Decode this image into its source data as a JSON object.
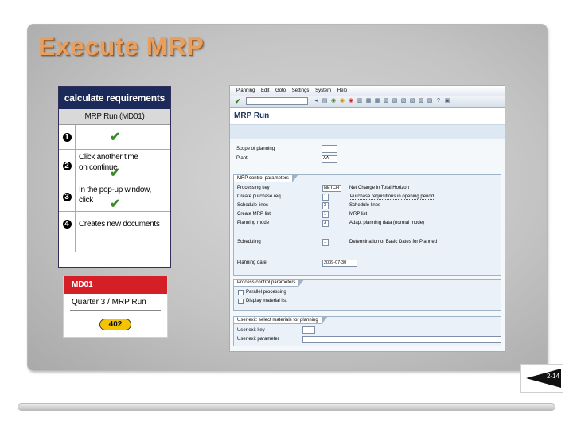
{
  "slide": {
    "title": "Execute MRP",
    "page_number": "2-14"
  },
  "steps_table": {
    "header": "calculate requirements",
    "subheader": "MRP Run (MD01)",
    "steps": [
      {
        "number": "1",
        "text": "",
        "checked": true
      },
      {
        "number": "2",
        "text": "Click another time on continue",
        "checked": true
      },
      {
        "number": "3",
        "text": "In the pop-up window, click",
        "checked": true
      },
      {
        "number": "4",
        "text": "Creates new documents",
        "checked": false
      }
    ]
  },
  "transaction_badge": {
    "code": "MD01",
    "line": "Quarter 3 / MRP Run",
    "number": "402"
  },
  "sap": {
    "menu": [
      "Planning",
      "Edit",
      "Goto",
      "Settings",
      "System",
      "Help"
    ],
    "title": "MRP Run",
    "scope_label": "Scope of planning",
    "scope_value": "",
    "plant_label": "Plant",
    "plant_value": "AA",
    "mrp_group": {
      "tab": "MRP control parameters",
      "processing_key_label": "Processing key",
      "processing_key_value": "NETCH",
      "processing_key_desc": "Net Change in Total Horizon",
      "create_pur_label": "Create purchase req.",
      "create_pur_value": "1",
      "create_pur_desc": "Purchase requisitions in opening period",
      "schedule_label": "Schedule lines",
      "schedule_value": "3",
      "schedule_desc": "Schedule lines",
      "mrp_list_label": "Create MRP list",
      "mrp_list_value": "1",
      "mrp_list_desc": "MRP list",
      "planning_mode_label": "Planning mode",
      "planning_mode_value": "3",
      "planning_mode_desc": "Adapt planning data (normal mode)",
      "scheduling_label": "Scheduling",
      "scheduling_value": "1",
      "scheduling_desc": "Determination of Basic Dates for Planned",
      "planning_date_label": "Planning date",
      "planning_date_value": "2009-07-30"
    },
    "process_group": {
      "tab": "Process control parameters",
      "parallel_label": "Parallel processing",
      "display_label": "Display material list"
    },
    "user_exit_group": {
      "tab": "User exit: select materials for planning",
      "key_label": "User exit key",
      "key_value": "",
      "param_label": "User exit parameter",
      "param_value": ""
    }
  }
}
